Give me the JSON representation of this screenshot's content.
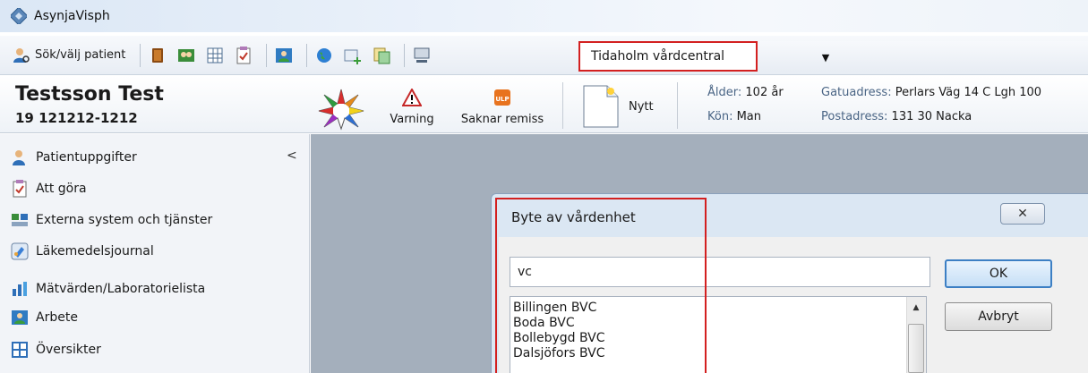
{
  "window": {
    "title": "AsynjaVisph"
  },
  "toolbar": {
    "search_patient_label": "Sök/välj patient",
    "unit_selected": "Tidaholm vårdcentral"
  },
  "patient": {
    "name": "Testsson Test",
    "id": "19 121212-1212",
    "warning_label": "Varning",
    "referral_label": "Saknar remiss",
    "new_label": "Nytt",
    "age_label": "Ålder:",
    "age_value": "102 år",
    "sex_label": "Kön:",
    "sex_value": "Man",
    "street_label": "Gatuadress:",
    "street_value": "Perlars Väg 14 C Lgh 100",
    "postal_label": "Postadress:",
    "postal_value": "131 30 Nacka"
  },
  "sidebar": {
    "items": [
      {
        "label": "Patientuppgifter"
      },
      {
        "label": "Att göra"
      },
      {
        "label": "Externa system och tjänster"
      },
      {
        "label": "Läkemedelsjournal"
      },
      {
        "label": "Mätvärden/Laboratorielista"
      },
      {
        "label": "Arbete"
      },
      {
        "label": "Översikter"
      }
    ],
    "collapse_glyph": "<"
  },
  "dialog": {
    "title": "Byte av vårdenhet",
    "search_value": "vc",
    "ok_label": "OK",
    "cancel_label": "Avbryt",
    "list": [
      {
        "label": "Billingen BVC"
      },
      {
        "label": "Boda BVC"
      },
      {
        "label": "Bollebygd BVC"
      },
      {
        "label": "Dalsjöfors BVC"
      }
    ]
  },
  "colors": {
    "highlight_red": "#d32020",
    "main_background": "#a4afbc",
    "dialog_frame": "#dbe7f3"
  }
}
